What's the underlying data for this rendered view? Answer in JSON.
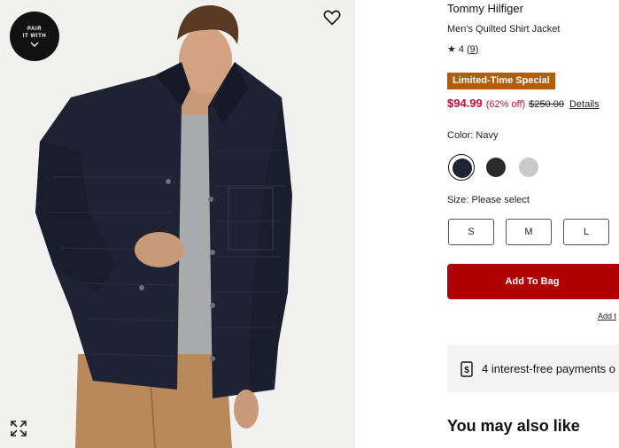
{
  "image": {
    "pair_badge": {
      "line1": "PAIR",
      "line2": "IT WITH"
    }
  },
  "product": {
    "brand": "Tommy Hilfiger",
    "name": "Men's Quilted Shirt Jacket",
    "rating": "4",
    "review_count": "(9)",
    "promo": "Limited-Time Special",
    "sale_price": "$94.99",
    "discount": "(62% off)",
    "original_price": "$250.00",
    "details_link": "Details"
  },
  "color": {
    "label": "Color: Navy",
    "swatches": [
      {
        "name": "Navy",
        "hex": "#1f2333",
        "selected": true
      },
      {
        "name": "Black",
        "hex": "#2a2a2a",
        "selected": false
      },
      {
        "name": "Gray",
        "hex": "#c9c9c9",
        "selected": false
      }
    ]
  },
  "size": {
    "label": "Size: Please select",
    "options": [
      "S",
      "M",
      "L"
    ]
  },
  "actions": {
    "add_to_bag": "Add To Bag",
    "add_to_link": "Add t"
  },
  "installments": {
    "text": "4 interest-free payments o"
  },
  "recommendations": {
    "title": "You may also like"
  },
  "colors": {
    "sale_red": "#c8102e",
    "promo_orange": "#b35d0c",
    "bag_red": "#b00000"
  }
}
